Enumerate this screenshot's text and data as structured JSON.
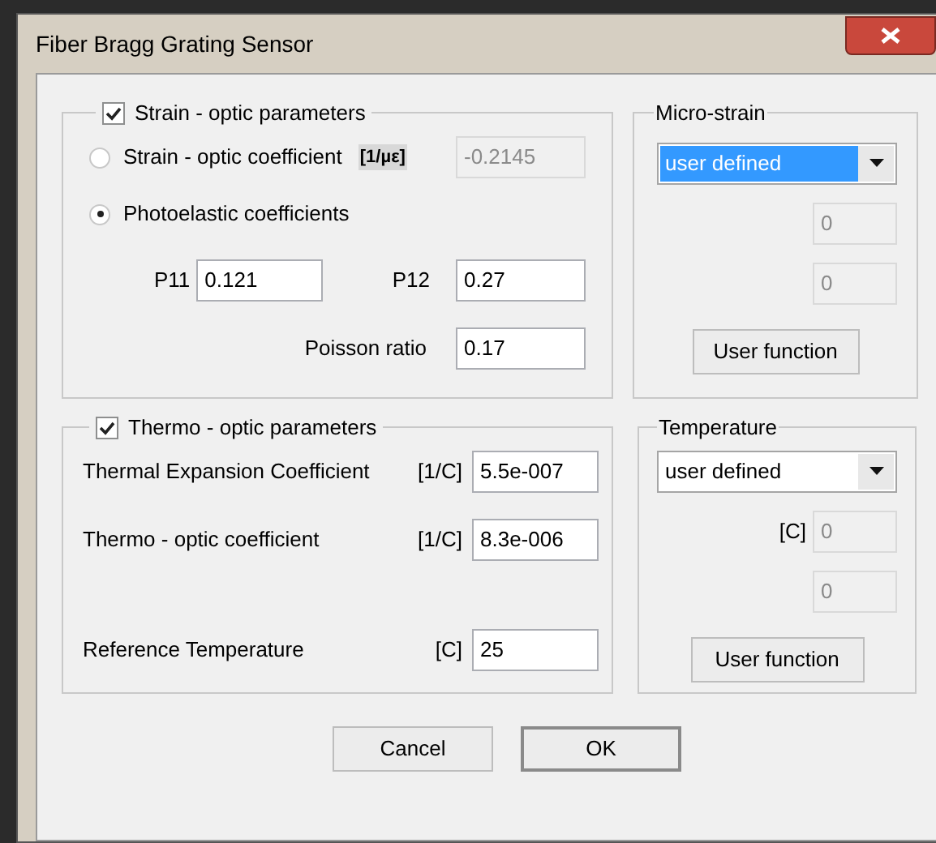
{
  "window": {
    "title": "Fiber Bragg Grating Sensor"
  },
  "strain_group": {
    "label": "Strain - optic parameters",
    "checked": true,
    "options": [
      {
        "label": "Strain - optic coefficient",
        "selected": false,
        "unit": "[1/µε]",
        "value": "-0.2145"
      },
      {
        "label": "Photoelastic coefficients",
        "selected": true
      }
    ],
    "p11": {
      "label": "P11",
      "value": "0.121"
    },
    "p12": {
      "label": "P12",
      "value": "0.27"
    },
    "poisson": {
      "label": "Poisson ratio",
      "value": "0.17"
    }
  },
  "micro_strain": {
    "title": "Micro-strain",
    "dropdown": {
      "value": "user defined",
      "focused": true
    },
    "fields": [
      {
        "value": "0",
        "disabled": true
      },
      {
        "value": "0",
        "disabled": true
      }
    ],
    "button": "User function"
  },
  "thermo_group": {
    "label": "Thermo - optic parameters",
    "checked": true,
    "rows": [
      {
        "label": "Thermal Expansion Coefficient",
        "unit": "[1/C]",
        "value": "5.5e-007"
      },
      {
        "label": "Thermo - optic coefficient",
        "unit": "[1/C]",
        "value": "8.3e-006"
      },
      {
        "label": "Reference Temperature",
        "unit": "[C]",
        "value": "25"
      }
    ]
  },
  "temperature": {
    "title": "Temperature",
    "dropdown": {
      "value": "user defined",
      "focused": false
    },
    "fields": [
      {
        "unit": "[C]",
        "value": "0",
        "disabled": true
      },
      {
        "value": "0",
        "disabled": true
      }
    ],
    "button": "User function"
  },
  "buttons": [
    {
      "label": "Cancel",
      "default": false
    },
    {
      "label": "OK",
      "default": true
    }
  ]
}
